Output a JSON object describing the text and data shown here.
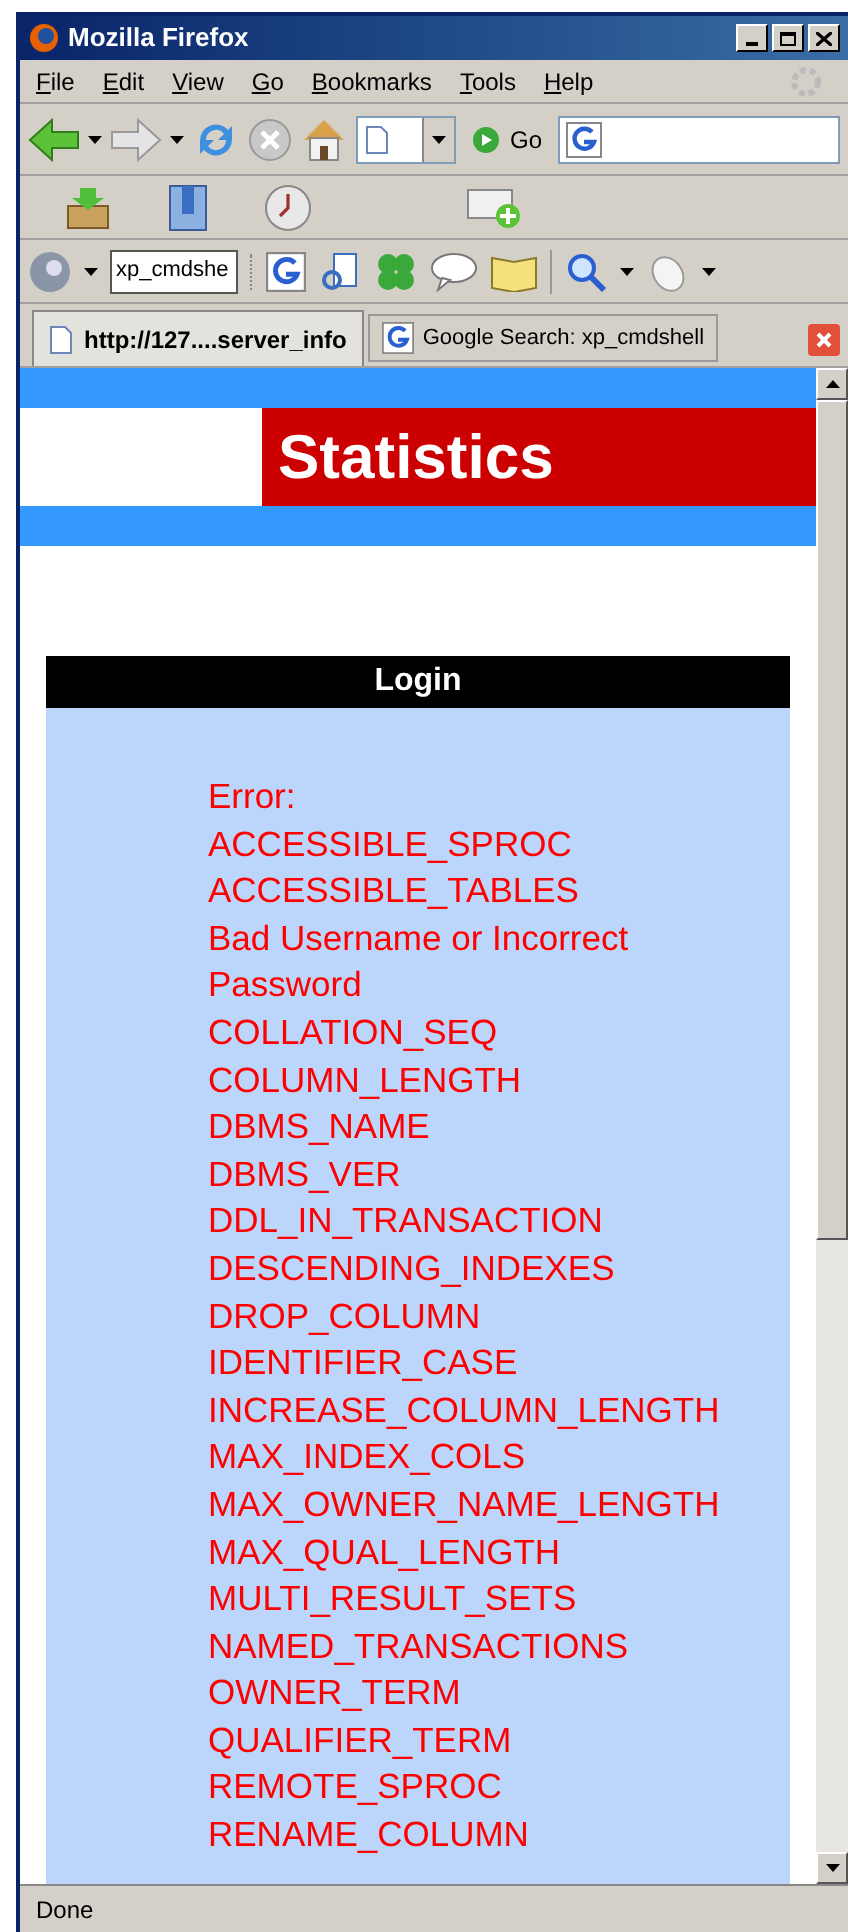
{
  "window": {
    "title": "Mozilla Firefox"
  },
  "menu": [
    {
      "label": "File"
    },
    {
      "label": "Edit"
    },
    {
      "label": "View"
    },
    {
      "label": "Go"
    },
    {
      "label": "Bookmarks"
    },
    {
      "label": "Tools"
    },
    {
      "label": "Help"
    }
  ],
  "navigation": {
    "go_label": "Go"
  },
  "google_toolbar": {
    "search_value": "xp_cmdshe"
  },
  "tabs": [
    {
      "label": "http://127....server_info",
      "selected": true
    },
    {
      "label": "Google Search: xp_cmdshell",
      "selected": false
    }
  ],
  "page": {
    "banner_title": "Statistics",
    "panel_title": "Login",
    "messages": [
      "Error:",
      "ACCESSIBLE_SPROC",
      "ACCESSIBLE_TABLES",
      "Bad Username or Incorrect Password",
      "COLLATION_SEQ",
      "COLUMN_LENGTH",
      "DBMS_NAME",
      "DBMS_VER",
      "DDL_IN_TRANSACTION",
      "DESCENDING_INDEXES",
      "DROP_COLUMN",
      "IDENTIFIER_CASE",
      "INCREASE_COLUMN_LENGTH",
      "MAX_INDEX_COLS",
      "MAX_OWNER_NAME_LENGTH",
      "MAX_QUAL_LENGTH",
      "MULTI_RESULT_SETS",
      "NAMED_TRANSACTIONS",
      "OWNER_TERM",
      "QUALIFIER_TERM",
      "REMOTE_SPROC",
      "RENAME_COLUMN"
    ]
  },
  "status_bar": {
    "text": "Done"
  }
}
